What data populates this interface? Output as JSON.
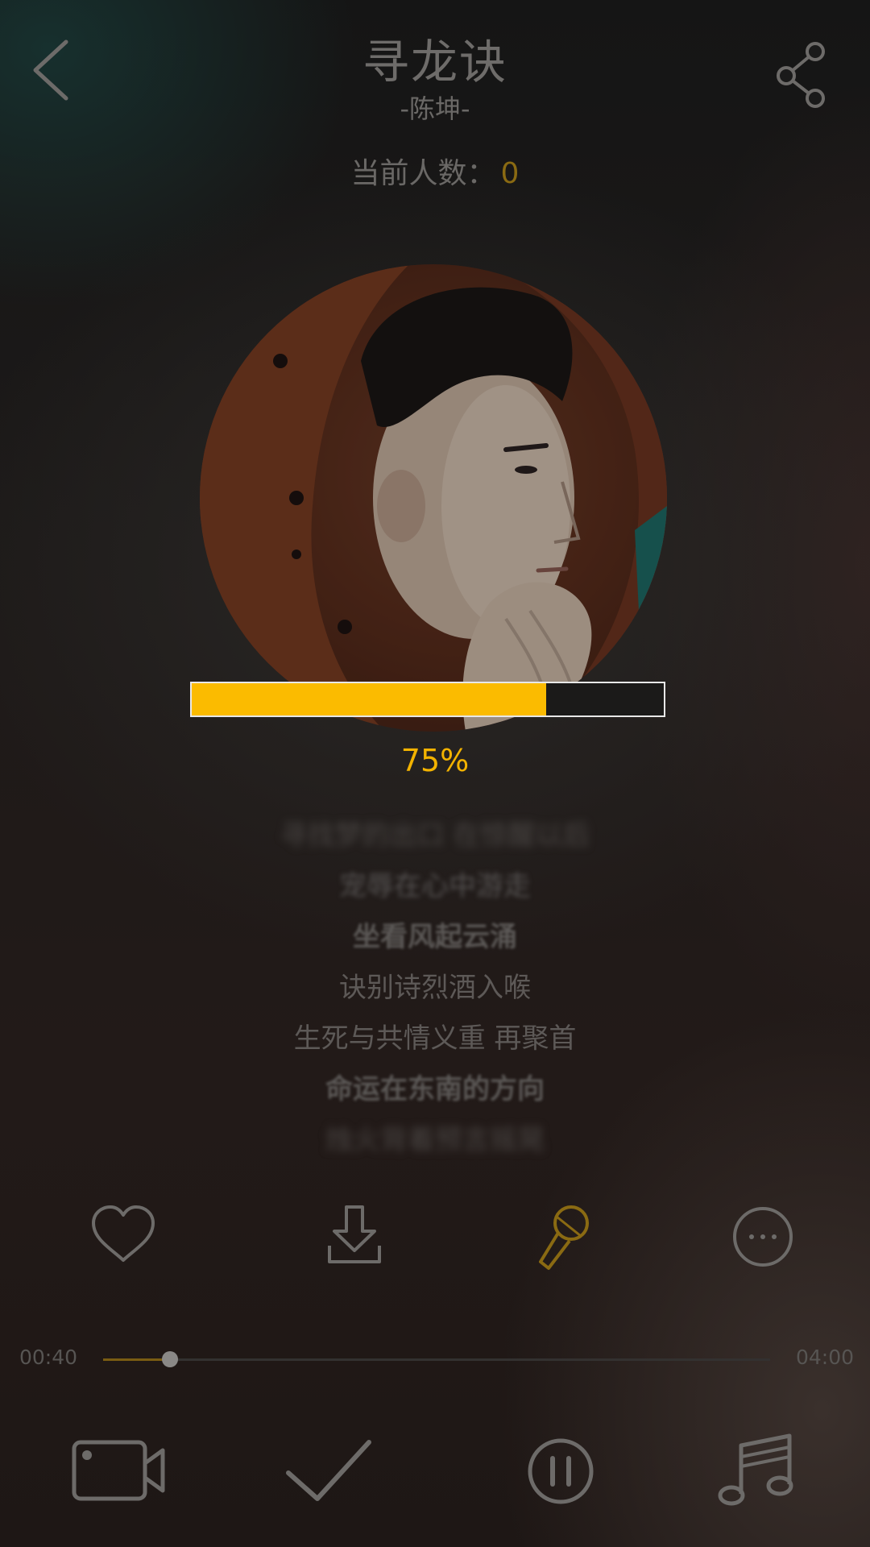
{
  "header": {
    "title": "寻龙诀",
    "artist": "-陈坤-",
    "listeners_label": "当前人数：",
    "listeners_count": "0"
  },
  "icons": {
    "back": "chevron-left-icon",
    "share": "share-icon",
    "like": "heart-icon",
    "download": "download-icon",
    "sing": "microphone-icon",
    "more": "more-icon",
    "video": "video-camera-icon",
    "check": "check-icon",
    "pause": "pause-icon",
    "music": "music-note-icon"
  },
  "download": {
    "progress": 0.75,
    "percent_label": "75%"
  },
  "lyrics": [
    "寻找梦的出口 在惊醒以后",
    "宠辱在心中游走",
    "坐看风起云涌",
    "诀别诗烈酒入喉",
    "生死与共情义重 再聚首",
    "命运在东南的方向",
    "烛火背着预言摇晃"
  ],
  "playback": {
    "current_time": "00:40",
    "total_time": "04:00",
    "progress": 0.1
  },
  "colors": {
    "accent": "#fbbb00",
    "accent_dim": "#8a6a12",
    "icon_gray": "#6d6b69"
  }
}
